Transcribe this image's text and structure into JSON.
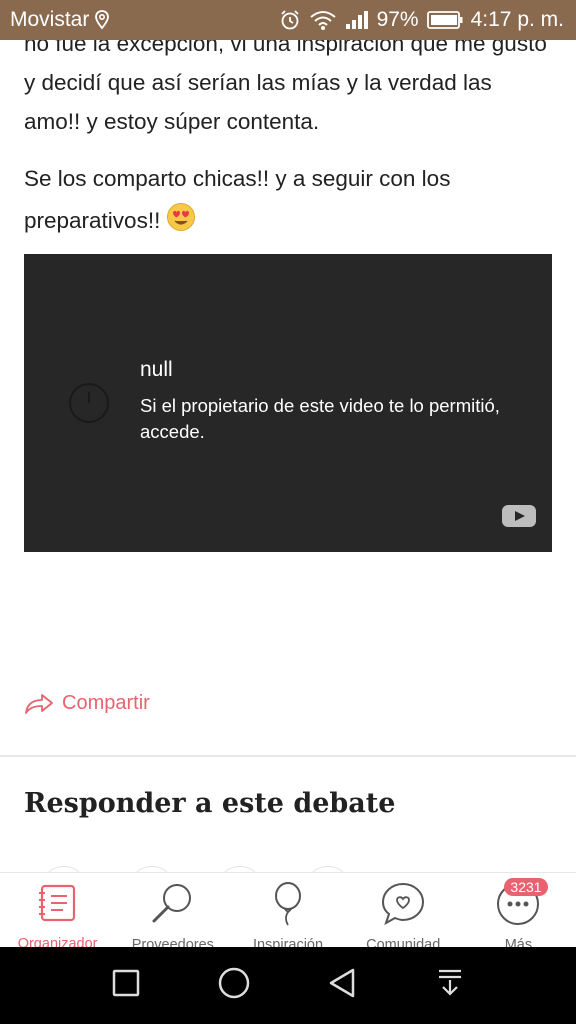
{
  "status_bar": {
    "carrier": "Movistar",
    "battery_percent": "97%",
    "time": "4:17 p. m."
  },
  "post": {
    "paragraph_1": "no fue la excepción, vi una inspiración que me gustó y decidí que así serían las mías y la verdad las amo!! y estoy súper contenta.",
    "paragraph_2": "Se los comparto chicas!! y a seguir con los preparativos!!",
    "emoji": "heart-eyes-emoji"
  },
  "video": {
    "title": "null",
    "message": "Si el propietario de este video te lo permitió, accede."
  },
  "share_label": "Compartir",
  "reply_heading": "Responder a este debate",
  "bottom_nav": {
    "items": [
      {
        "label": "Organizador",
        "icon": "planner-icon",
        "active": true
      },
      {
        "label": "Proveedores",
        "icon": "search-icon"
      },
      {
        "label": "Inspiración",
        "icon": "balloon-icon"
      },
      {
        "label": "Comunidad",
        "icon": "chat-heart-icon"
      },
      {
        "label": "Más",
        "icon": "more-icon",
        "badge": "3231"
      }
    ]
  },
  "colors": {
    "accent": "#e8636f",
    "status_bar": "#8a6a4f",
    "video_bg": "#272727"
  }
}
